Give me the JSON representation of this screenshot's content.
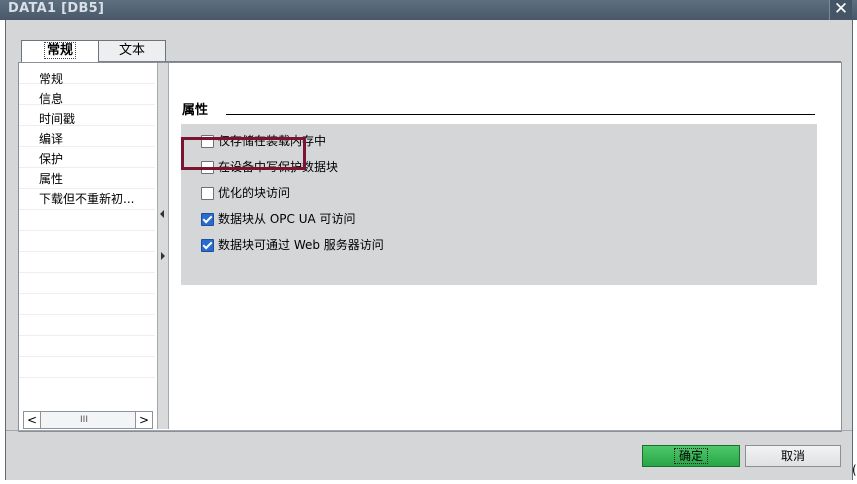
{
  "window": {
    "title": "DATA1 [DB5]",
    "close_glyph": "✕"
  },
  "tabs": [
    {
      "label": "常规",
      "active": true
    },
    {
      "label": "文本",
      "active": false
    }
  ],
  "nav": {
    "items": [
      "常规",
      "信息",
      "时间戳",
      "编译",
      "保护",
      "属性",
      "下载但不重新初..."
    ],
    "selected_index": 5,
    "scroll_left_glyph": "<",
    "scroll_right_glyph": ">",
    "scroll_thumb_glyph": "III"
  },
  "section": {
    "title": "属性"
  },
  "options": [
    {
      "label": "仅存储在装载内存中",
      "checked": false
    },
    {
      "label": "在设备中写保护数据块",
      "checked": false
    },
    {
      "label": "优化的块访问",
      "checked": false,
      "highlighted": true
    },
    {
      "label": "数据块从 OPC UA 可访问",
      "checked": true
    },
    {
      "label": "数据块可通过 Web 服务器访问",
      "checked": true
    }
  ],
  "buttons": {
    "ok": "确定",
    "cancel": "取消"
  },
  "edge_char": "(",
  "colors": {
    "title_bar": "#5a6b7b",
    "dialog_bg": "#d4d6d8",
    "highlight_border": "#7c1331",
    "ok_button": "#3cba5a",
    "checkbox_checked": "#2a6bd0"
  }
}
